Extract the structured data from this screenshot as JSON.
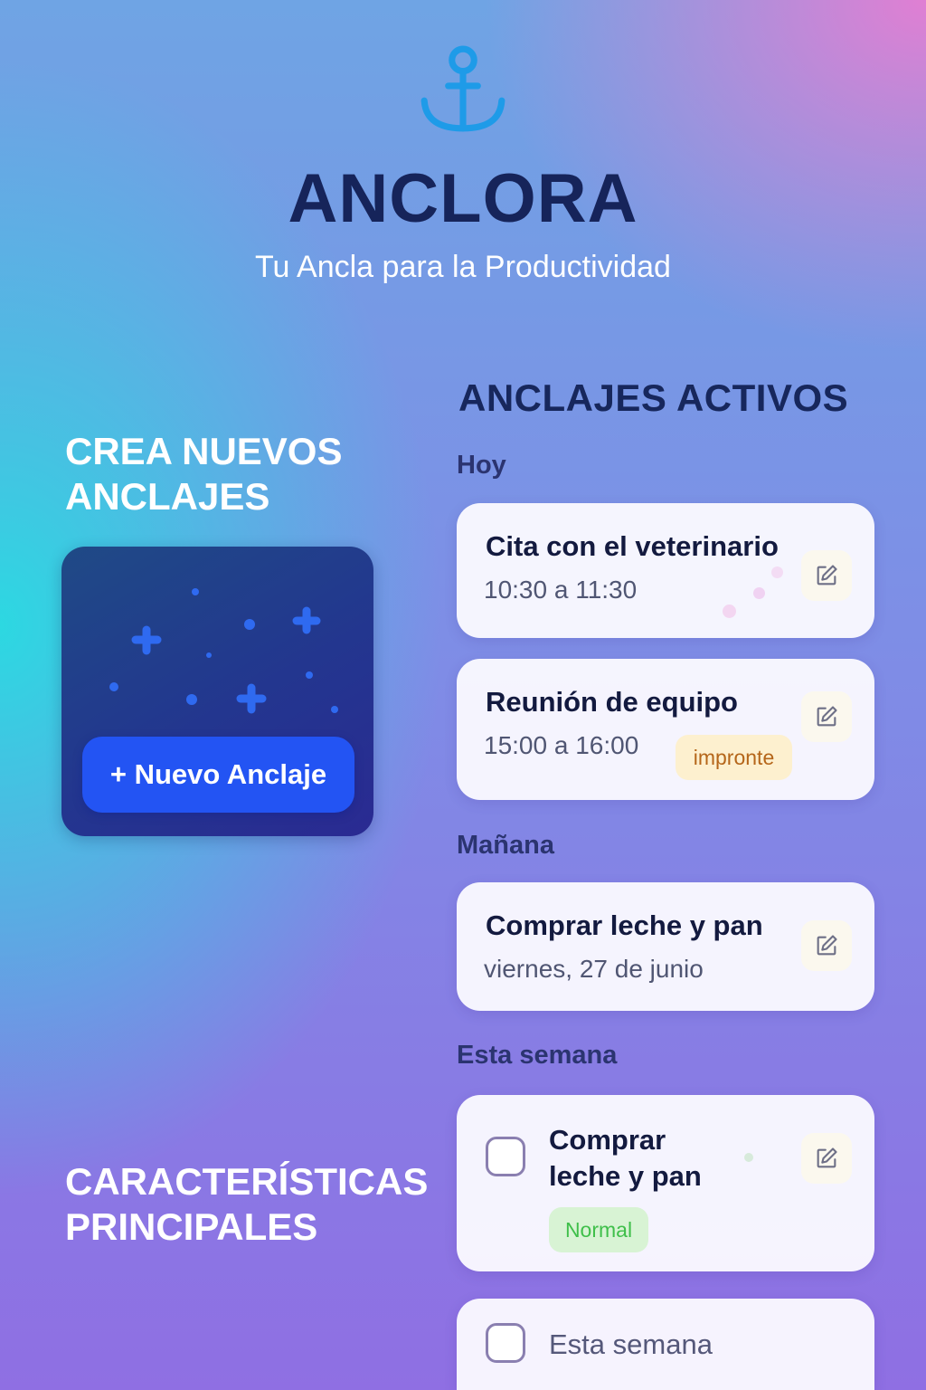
{
  "app": {
    "name": "ANCLORA",
    "tagline": "Tu Ancla para la Productividad",
    "logo_icon": "anchor-icon",
    "accent": "#2354f3"
  },
  "create_section": {
    "title": "CREA NUEVOS ANCLAJES",
    "button_label": "+ Nuevo Anclaje"
  },
  "features_section": {
    "title": "CARACTERÍSTICAS PRINCIPALES"
  },
  "active": {
    "title": "ANCLAJES ACTIVOS",
    "groups": [
      {
        "label": "Hoy",
        "items": [
          {
            "title": "Cita con el veterinario",
            "time": "10:30 a 11:30"
          },
          {
            "title": "Reunión de equipo",
            "time": "15:00 a 16:00",
            "badge": "impronte",
            "badge_color": "#b5661a"
          }
        ]
      },
      {
        "label": "Mañana",
        "items": [
          {
            "title": "Comprar leche y pan",
            "time": "viernes, 27 de junio"
          }
        ]
      },
      {
        "label": "Esta semana",
        "items": [
          {
            "title": "Comprar leche y pan",
            "badge": "Normal",
            "badge_color": "#3fbf4a",
            "checked": false
          },
          {
            "title": "Esta semana",
            "checked": false
          }
        ]
      }
    ]
  }
}
